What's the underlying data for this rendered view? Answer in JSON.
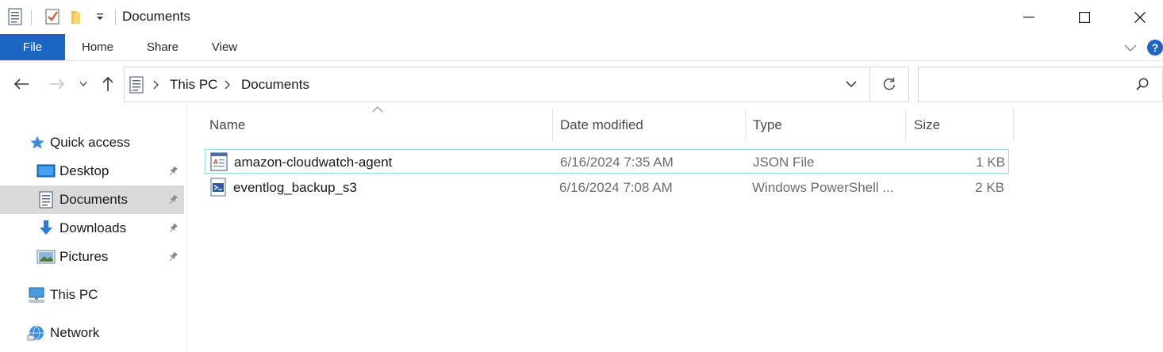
{
  "window": {
    "title": "Documents",
    "controls": {
      "minimize": "minimize",
      "maximize": "maximize",
      "close": "close"
    }
  },
  "ribbon": {
    "tabs": [
      "File",
      "Home",
      "Share",
      "View"
    ],
    "help_label": "?"
  },
  "address": {
    "crumbs": [
      "This PC",
      "Documents"
    ],
    "search_placeholder": ""
  },
  "nav": {
    "quick_access": "Quick access",
    "items": [
      {
        "label": "Desktop",
        "icon": "desktop-icon",
        "pinned": true
      },
      {
        "label": "Documents",
        "icon": "documents-icon",
        "pinned": true,
        "selected": true
      },
      {
        "label": "Downloads",
        "icon": "downloads-icon",
        "pinned": true
      },
      {
        "label": "Pictures",
        "icon": "pictures-icon",
        "pinned": true
      }
    ],
    "this_pc": "This PC",
    "network": "Network"
  },
  "columns": {
    "name": "Name",
    "date": "Date modified",
    "type": "Type",
    "size": "Size"
  },
  "files": [
    {
      "name": "amazon-cloudwatch-agent",
      "date": "6/16/2024 7:35 AM",
      "type": "JSON File",
      "size": "1 KB",
      "icon": "json-file-icon",
      "selected": true
    },
    {
      "name": "eventlog_backup_s3",
      "date": "6/16/2024 7:08 AM",
      "type": "Windows PowerShell ...",
      "size": "2 KB",
      "icon": "powershell-file-icon",
      "selected": false
    }
  ],
  "colors": {
    "accent": "#1a66c2",
    "selection_border": "#99d9ea",
    "nav_selected": "#d9d9d9"
  }
}
